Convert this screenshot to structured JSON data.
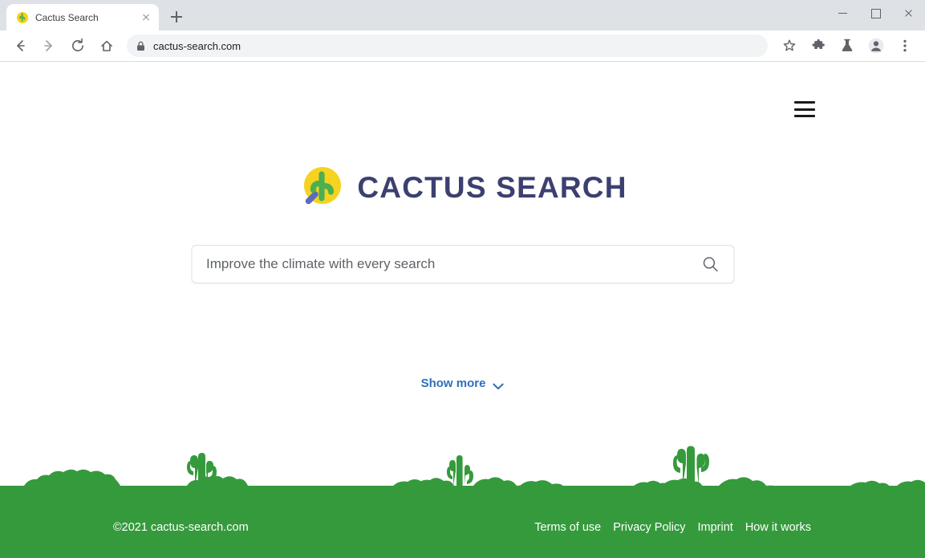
{
  "browser": {
    "tab": {
      "title": "Cactus Search",
      "favicon_icon": "cactus-favicon",
      "close_icon": "close-icon"
    },
    "new_tab_icon": "plus-icon",
    "window_controls": {
      "minimize_icon": "minimize-icon",
      "maximize_icon": "maximize-icon",
      "close_icon": "close-icon"
    },
    "toolbar": {
      "back_icon": "back-arrow-icon",
      "forward_icon": "forward-arrow-icon",
      "reload_icon": "reload-icon",
      "home_icon": "home-icon",
      "lock_icon": "lock-icon",
      "url": "cactus-search.com",
      "bookmark_icon": "star-icon",
      "extensions_icon": "puzzle-piece-icon",
      "labs_icon": "flask-icon",
      "profile_icon": "profile-avatar-icon",
      "menu_icon": "three-dot-menu-icon"
    }
  },
  "page": {
    "menu_icon": "hamburger-menu-icon",
    "logo": {
      "mark_icon": "cactus-magnifier-logo",
      "text": "CACTUS SEARCH",
      "text_color": "#3c4070",
      "circle_color": "#f5d320",
      "cactus_color": "#4caf50",
      "handle_color": "#5c6bc0"
    },
    "search": {
      "value": "",
      "placeholder": "Improve the climate with every search",
      "submit_icon": "search-magnifier-icon"
    },
    "show_more": {
      "label": "Show more",
      "icon": "chevron-down-icon",
      "color": "#2f6fba"
    },
    "scene": {
      "icon": "desert-cactus-silhouette",
      "color": "#359a3c"
    },
    "footer": {
      "copyright": "©2021 cactus-search.com",
      "background_color": "#359a3c",
      "links": [
        {
          "label": "Terms of use"
        },
        {
          "label": "Privacy Policy"
        },
        {
          "label": "Imprint"
        },
        {
          "label": "How it works"
        }
      ]
    }
  }
}
